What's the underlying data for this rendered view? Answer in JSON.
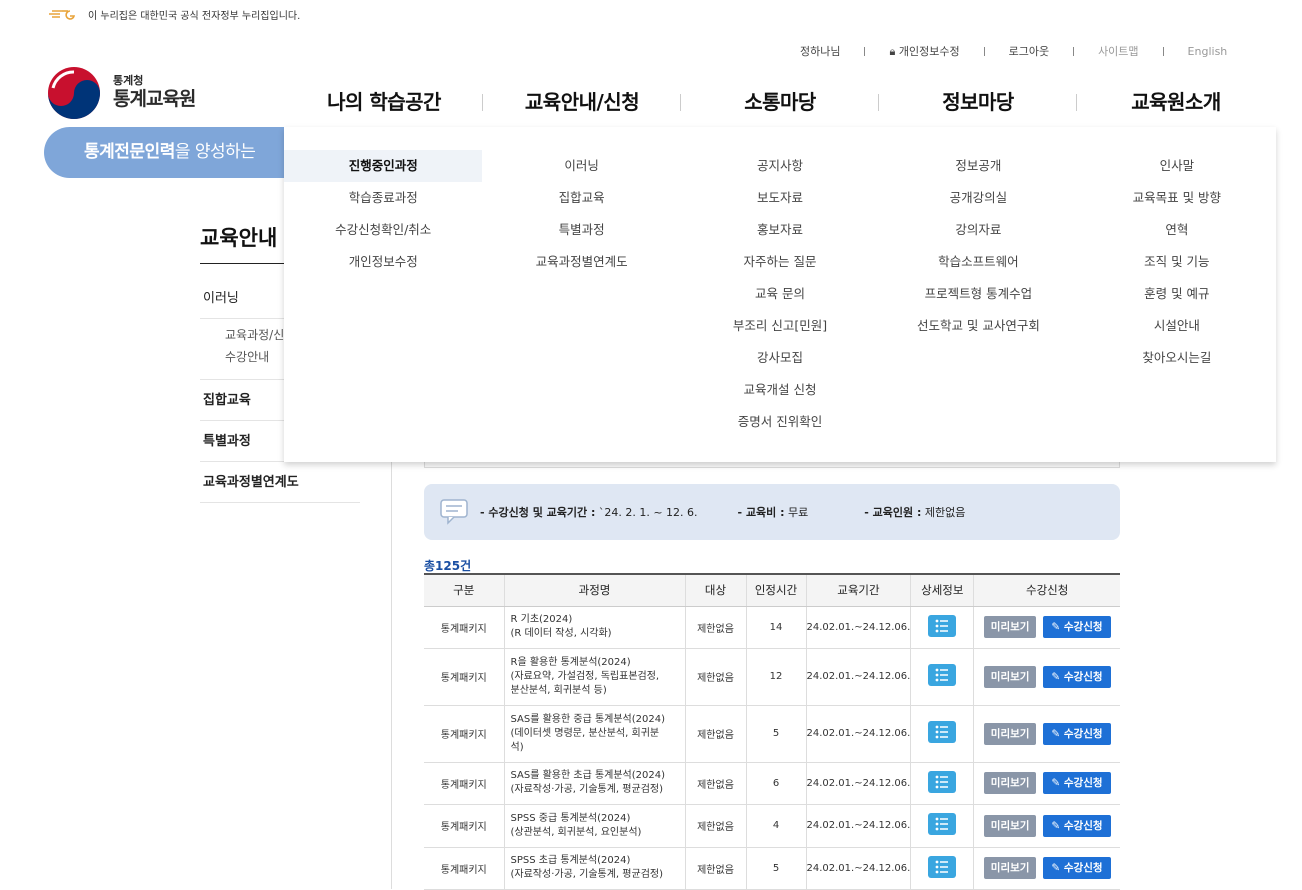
{
  "gov_banner": {
    "text": "이 누리집은 대한민국 공식 전자정부 누리집입니다."
  },
  "util_links": [
    "정하나님",
    "개인정보수정",
    "로그아웃",
    "사이트맵",
    "English"
  ],
  "logo": {
    "org": "통계청",
    "name": "통계교육원"
  },
  "gnb": [
    "나의 학습공간",
    "교육안내/신청",
    "소통마당",
    "정보마당",
    "교육원소개"
  ],
  "banner": {
    "strong": "통계전문인력",
    "rest": "을 양성하는"
  },
  "mega_menu": [
    [
      "진행중인과정",
      "학습종료과정",
      "수강신청확인/취소",
      "개인정보수정"
    ],
    [
      "이러닝",
      "집합교육",
      "특별과정",
      "교육과정별연계도"
    ],
    [
      "공지사항",
      "보도자료",
      "홍보자료",
      "자주하는 질문",
      "교육 문의",
      "부조리 신고[민원]",
      "강사모집",
      "교육개설 신청",
      "증명서 진위확인"
    ],
    [
      "정보공개",
      "공개강의실",
      "강의자료",
      "학습소프트웨어",
      "프로젝트형 통계수업",
      "선도학교 및 교사연구회"
    ],
    [
      "인사말",
      "교육목표 및 방향",
      "연혁",
      "조직 및 기능",
      "훈령 및 예규",
      "시설안내",
      "찾아오시는길"
    ]
  ],
  "lnb": {
    "title": "교육안내",
    "items": [
      "이러닝",
      "집합교육",
      "특별과정",
      "교육과정별연계도"
    ],
    "sub": [
      "교육과정/신청",
      "수강안내"
    ]
  },
  "info": {
    "period_label": "- 수강신청 및 교육기간 :",
    "period_value": " `24. 2. 1. ~ 12. 6.",
    "fee_label": "- 교육비 :",
    "fee_value": " 무료",
    "people_label": "- 교육인원 :",
    "people_value": " 제한없음"
  },
  "total": "총125건",
  "table": {
    "headers": [
      "구분",
      "과정명",
      "대상",
      "인정시간",
      "교육기간",
      "상세정보",
      "수강신청"
    ],
    "preview_label": "미리보기",
    "apply_label": "수강신청",
    "rows": [
      {
        "cat": "통계패키지",
        "name": [
          "R 기초(2024)",
          "(R 데이터 작성, 시각화)"
        ],
        "target": "제한없음",
        "hours": "14",
        "period": "24.02.01.~24.12.06."
      },
      {
        "cat": "통계패키지",
        "name": [
          "R을 활용한 통계분석(2024)",
          "(자료요약, 가설검정, 독립표본검정,",
          "분산분석, 회귀분석 등)"
        ],
        "target": "제한없음",
        "hours": "12",
        "period": "24.02.01.~24.12.06."
      },
      {
        "cat": "통계패키지",
        "name": [
          "SAS를 활용한 중급 통계분석(2024)",
          "(데이터셋 명령문, 분산분석, 회귀분",
          "석)"
        ],
        "target": "제한없음",
        "hours": "5",
        "period": "24.02.01.~24.12.06."
      },
      {
        "cat": "통계패키지",
        "name": [
          "SAS를 활용한 초급 통계분석(2024)",
          "(자료작성·가공, 기술통계, 평균검정)"
        ],
        "target": "제한없음",
        "hours": "6",
        "period": "24.02.01.~24.12.06."
      },
      {
        "cat": "통계패키지",
        "name": [
          "SPSS 중급 통계분석(2024)",
          "(상관분석, 회귀분석, 요인분석)"
        ],
        "target": "제한없음",
        "hours": "4",
        "period": "24.02.01.~24.12.06."
      },
      {
        "cat": "통계패키지",
        "name": [
          "SPSS 초급 통계분석(2024)",
          "(자료작성·가공, 기술통계, 평균검정)"
        ],
        "target": "제한없음",
        "hours": "5",
        "period": "24.02.01.~24.12.06."
      }
    ]
  }
}
